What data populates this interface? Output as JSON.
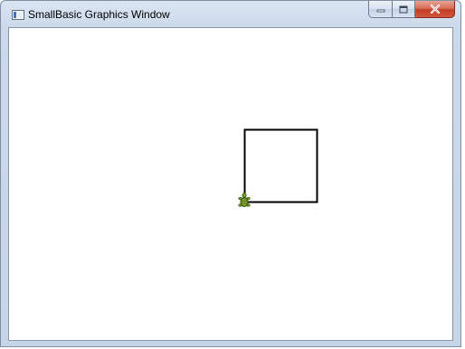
{
  "window": {
    "title": "SmallBasic Graphics Window",
    "icons": {
      "app": "smallbasic-window-icon",
      "minimize": "minimize-icon",
      "maximize": "maximize-icon",
      "close": "close-icon"
    },
    "colors": {
      "close_button": "#c9462c",
      "frame": "#cbd9ea"
    }
  },
  "canvas": {
    "background": "#ffffff",
    "drawing": {
      "shape": "square",
      "line_color": "#000000"
    },
    "turtle": {
      "icon": "turtle-icon",
      "color": "#5a8a1a"
    }
  }
}
